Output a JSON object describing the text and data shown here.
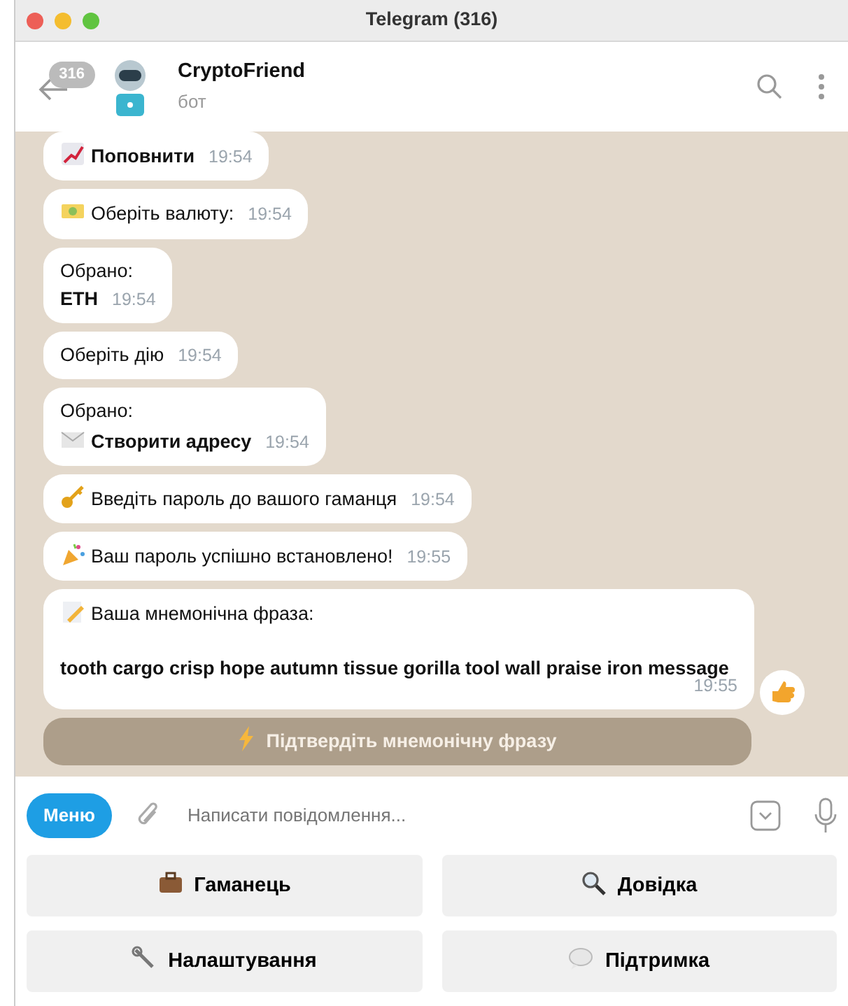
{
  "window": {
    "title": "Telegram (316)"
  },
  "header": {
    "unread": "316",
    "name": "CryptoFriend",
    "status": "бот"
  },
  "messages": [
    {
      "lines": [
        {
          "text": "Поповнити",
          "bold": true
        }
      ],
      "time": "19:54"
    },
    {
      "lines": [
        {
          "text": "Оберіть валюту:",
          "bold": false
        }
      ],
      "time": "19:54"
    },
    {
      "lines": [
        {
          "text": "Обрано:",
          "bold": false
        },
        {
          "text": "ETH",
          "bold": true
        }
      ],
      "time": "19:54"
    },
    {
      "lines": [
        {
          "text": "Оберіть дію",
          "bold": false
        }
      ],
      "time": "19:54"
    },
    {
      "lines": [
        {
          "text": "Обрано:",
          "bold": false
        },
        {
          "text": "Створити адресу",
          "bold": true
        }
      ],
      "time": "19:54"
    },
    {
      "lines": [
        {
          "text": "Введіть пароль до вашого гаманця",
          "bold": false
        }
      ],
      "time": "19:54"
    },
    {
      "lines": [
        {
          "text": "Ваш пароль успішно встановлено!",
          "bold": false
        }
      ],
      "time": "19:55"
    },
    {
      "lines": [
        {
          "text": "Ваша мнемонічна фраза:",
          "bold": false
        },
        {
          "text": "tooth cargo crisp hope autumn tissue gorilla tool wall praise iron message",
          "bold": true
        }
      ],
      "time": "19:55",
      "reaction": true
    }
  ],
  "inline_button": "Підтвердіть мнемонічну фразу",
  "composer": {
    "menu": "Меню",
    "placeholder": "Написати повідомлення..."
  },
  "keyboard": [
    "Гаманець",
    "Довідка",
    "Налаштування",
    "Підтримка"
  ]
}
